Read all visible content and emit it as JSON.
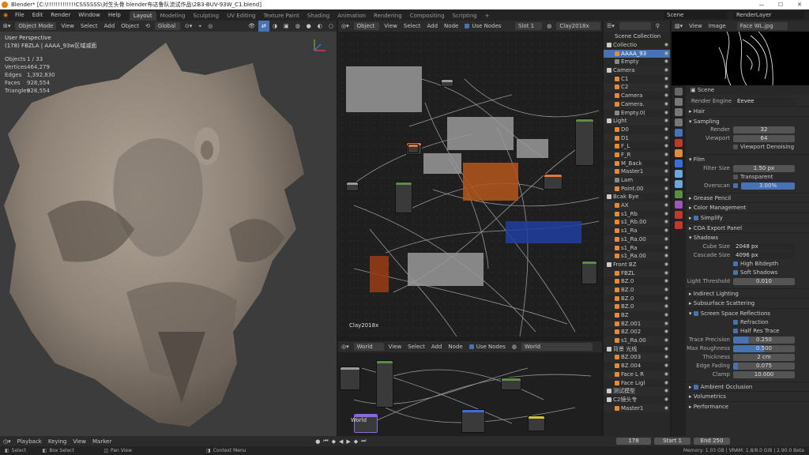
{
  "titlebar": {
    "title": "Blender* [C:\\!!!!!!!!!!!!!CSSSSSS\\对生头骨 blender布达鲁队流试作品\\2B3-BUV-93W_C1.blend]",
    "minimize": "—",
    "maximize": "☐",
    "close": "✕"
  },
  "topbar": {
    "menus": [
      "File",
      "Edit",
      "Render",
      "Window",
      "Help"
    ],
    "workspaces": [
      "Layout",
      "Modeling",
      "Sculpting",
      "UV Editing",
      "Texture Paint",
      "Shading",
      "Animation",
      "Rendering",
      "Compositing",
      "Scripting"
    ],
    "active_workspace": "Layout",
    "add_tab": "+",
    "scene": "Scene",
    "view_layer": "RenderLayer"
  },
  "viewport": {
    "mode": "Object Mode",
    "menus": [
      "View",
      "Select",
      "Add",
      "Object"
    ],
    "transform": "Global",
    "perspective": "User Perspective",
    "object_name": "(178) FBZLA | AAAA_93w区域减面",
    "stats": [
      {
        "label": "Objects",
        "value": "1 / 33"
      },
      {
        "label": "Vertices",
        "value": "464,279"
      },
      {
        "label": "Edges",
        "value": "1,392,830"
      },
      {
        "label": "Faces",
        "value": "928,554"
      },
      {
        "label": "Triangles",
        "value": "928,554"
      }
    ]
  },
  "node_editor": {
    "type": "Object",
    "menus": [
      "View",
      "Select",
      "Add",
      "Node"
    ],
    "use_nodes": "Use Nodes",
    "slot": "Slot 1",
    "material": "Clay2018x",
    "label": "Clay2018x"
  },
  "world_editor": {
    "type": "World",
    "menus": [
      "View",
      "Select",
      "Add",
      "Node"
    ],
    "use_nodes": "Use Nodes",
    "world": "World",
    "label": "World"
  },
  "outliner": {
    "title": "Scene Collection",
    "rows": [
      {
        "label": "Collectio",
        "color": "#cccccc",
        "selected": false
      },
      {
        "label": "AAAA_93",
        "color": "#e38b3c",
        "selected": true
      },
      {
        "label": "Empty",
        "color": "#888888",
        "selected": false
      },
      {
        "label": "Camera",
        "color": "#cccccc",
        "selected": false
      },
      {
        "label": "C1",
        "color": "#e38b3c",
        "selected": false
      },
      {
        "label": "C2",
        "color": "#e38b3c",
        "selected": false
      },
      {
        "label": "Camera",
        "color": "#e38b3c",
        "selected": false
      },
      {
        "label": "Camera.",
        "color": "#e38b3c",
        "selected": false
      },
      {
        "label": "Empty.0(",
        "color": "#888888",
        "selected": false
      },
      {
        "label": "Light",
        "color": "#cccccc",
        "selected": false
      },
      {
        "label": "D0",
        "color": "#e38b3c",
        "selected": false
      },
      {
        "label": "D1",
        "color": "#e38b3c",
        "selected": false
      },
      {
        "label": "F_L",
        "color": "#e38b3c",
        "selected": false
      },
      {
        "label": "F_R",
        "color": "#e38b3c",
        "selected": false
      },
      {
        "label": "M_Back",
        "color": "#e38b3c",
        "selected": false
      },
      {
        "label": "Master1",
        "color": "#e38b3c",
        "selected": false
      },
      {
        "label": "Lam",
        "color": "#888888",
        "selected": false
      },
      {
        "label": "Point.00",
        "color": "#e38b3c",
        "selected": false
      },
      {
        "label": "Bcak Bye",
        "color": "#cccccc",
        "selected": false
      },
      {
        "label": "AX",
        "color": "#e38b3c",
        "selected": false
      },
      {
        "label": "s1_Rb",
        "color": "#e38b3c",
        "selected": false
      },
      {
        "label": "s1_Rb.00",
        "color": "#e38b3c",
        "selected": false
      },
      {
        "label": "s1_Ra",
        "color": "#e38b3c",
        "selected": false
      },
      {
        "label": "s1_Ra.00",
        "color": "#e38b3c",
        "selected": false
      },
      {
        "label": "s1_Ra",
        "color": "#e38b3c",
        "selected": false
      },
      {
        "label": "s1_Ra.00",
        "color": "#e38b3c",
        "selected": false
      },
      {
        "label": "Front BZ",
        "color": "#cccccc",
        "selected": false
      },
      {
        "label": "FBZL",
        "color": "#e38b3c",
        "selected": false
      },
      {
        "label": "BZ.0",
        "color": "#e38b3c",
        "selected": false
      },
      {
        "label": "BZ.0",
        "color": "#e38b3c",
        "selected": false
      },
      {
        "label": "BZ.0",
        "color": "#e38b3c",
        "selected": false
      },
      {
        "label": "BZ.0",
        "color": "#e38b3c",
        "selected": false
      },
      {
        "label": "BZ",
        "color": "#e38b3c",
        "selected": false
      },
      {
        "label": "BZ.001",
        "color": "#e38b3c",
        "selected": false
      },
      {
        "label": "BZ.002",
        "color": "#e38b3c",
        "selected": false
      },
      {
        "label": "s1_Ra.00",
        "color": "#e38b3c",
        "selected": false
      },
      {
        "label": "背景 光线",
        "color": "#cccccc",
        "selected": false
      },
      {
        "label": "BZ.003",
        "color": "#e38b3c",
        "selected": false
      },
      {
        "label": "BZ.004",
        "color": "#e38b3c",
        "selected": false
      },
      {
        "label": "Face L R",
        "color": "#e38b3c",
        "selected": false
      },
      {
        "label": "Face Ligl",
        "color": "#e38b3c",
        "selected": false
      },
      {
        "label": "测试模型",
        "color": "#cccccc",
        "selected": false
      },
      {
        "label": "C2镜头专",
        "color": "#cccccc",
        "selected": false
      },
      {
        "label": "Master1",
        "color": "#e38b3c",
        "selected": false
      }
    ]
  },
  "image_editor": {
    "menus": [
      "View",
      "Image"
    ],
    "image": "Face WL.jpg"
  },
  "properties": {
    "context": "Scene",
    "render_engine_label": "Render Engine",
    "render_engine": "Eevee",
    "sections": {
      "hair": "Hair",
      "sampling": "Sampling",
      "film": "Film",
      "grease_pencil": "Grease Pencil",
      "color_management": "Color Management",
      "simplify": "Simplify",
      "coa": "COA Export Panel",
      "shadows": "Shadows",
      "indirect": "Indirect Lighting",
      "sss": "Subsurface Scattering",
      "ssr": "Screen Space Reflections",
      "ao": "Ambient Occlusion",
      "volumetrics": "Volumetrics",
      "performance": "Performance"
    },
    "sampling": {
      "render_label": "Render",
      "render": "32",
      "viewport_label": "Viewport",
      "viewport": "64",
      "denoise": "Viewport Denoising"
    },
    "film": {
      "filter_label": "Filter Size",
      "filter": "1.50 px",
      "transparent": "Transparent",
      "overscan_label": "Overscan",
      "overscan": "3.00%"
    },
    "shadows": {
      "cube_label": "Cube Size",
      "cube": "2048 px",
      "cascade_label": "Cascade Size",
      "cascade": "4096 px",
      "high_bit": "High Bitdepth",
      "soft": "Soft Shadows",
      "threshold_label": "Light Threshold",
      "threshold": "0.010"
    },
    "ssr": {
      "refraction": "Refraction",
      "half_res": "Half Res Trace",
      "fields": [
        {
          "label": "Trace Precision",
          "value": "0.250",
          "fill": 0.25
        },
        {
          "label": "Max Roughness",
          "value": "0.500",
          "fill": 0.5
        },
        {
          "label": "Thickness",
          "value": "2 cm",
          "fill": 0
        },
        {
          "label": "Edge Fading",
          "value": "0.075",
          "fill": 0.075
        },
        {
          "label": "Clamp",
          "value": "10.000",
          "fill": 0
        }
      ]
    }
  },
  "timeline": {
    "menus": [
      "Playback",
      "Keying",
      "View",
      "Marker"
    ],
    "current_frame": "178",
    "start_label": "Start",
    "start": "1",
    "end_label": "End",
    "end": "250"
  },
  "statusbar": {
    "select": "Select",
    "box_select": "Box Select",
    "pan_view": "Pan View",
    "context_menu": "Context Menu",
    "stats": "Memory: 1.03 GB | VRAM: 1.8/8.0 GiB | 2.90.0 Beta"
  }
}
